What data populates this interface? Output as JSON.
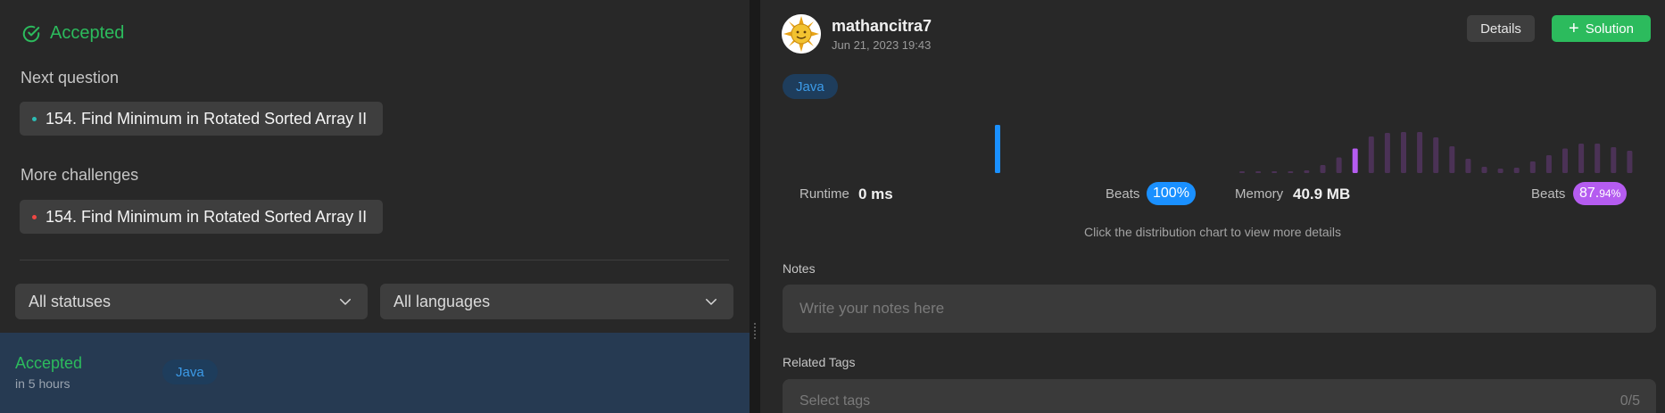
{
  "left": {
    "status": "Accepted",
    "next_question_label": "Next question",
    "next_question": "154. Find Minimum in Rotated Sorted Array II",
    "more_challenges_label": "More challenges",
    "more_challenge": "154. Find Minimum in Rotated Sorted Array II",
    "status_filter": "All statuses",
    "language_filter": "All languages",
    "submission": {
      "status": "Accepted",
      "time": "in 5 hours",
      "language": "Java"
    }
  },
  "right": {
    "username": "mathancitra7",
    "submitted_at": "Jun 21, 2023 19:43",
    "details_label": "Details",
    "solution_label": "Solution",
    "language": "Java",
    "runtime": {
      "label": "Runtime",
      "value": "0 ms",
      "beats_label": "Beats",
      "beats_value": "100%",
      "distribution": [
        1.0
      ],
      "highlight_index": 0
    },
    "memory": {
      "label": "Memory",
      "value": "40.9 MB",
      "beats_label": "Beats",
      "beats_main": "87.",
      "beats_frac": "94%",
      "distribution": [
        0.04,
        0.04,
        0.04,
        0.04,
        0.06,
        0.18,
        0.35,
        0.55,
        0.82,
        0.9,
        0.92,
        0.92,
        0.8,
        0.6,
        0.32,
        0.14,
        0.1,
        0.12,
        0.26,
        0.4,
        0.55,
        0.66,
        0.66,
        0.58,
        0.5
      ],
      "highlight_index": 7
    },
    "hint": "Click the distribution chart to view more details",
    "notes_label": "Notes",
    "notes_placeholder": "Write your notes here",
    "tags_label": "Related Tags",
    "tags_placeholder": "Select tags",
    "tags_count": "0/5",
    "colors": {
      "accepted": "#2cbb5d",
      "runtime_bar": "#1a90ff",
      "memory_bar": "#b55cf0",
      "memory_bar_dim": "#4b3256",
      "runtime_badge": "#1a90ff",
      "memory_badge": "#b55cf0"
    }
  }
}
